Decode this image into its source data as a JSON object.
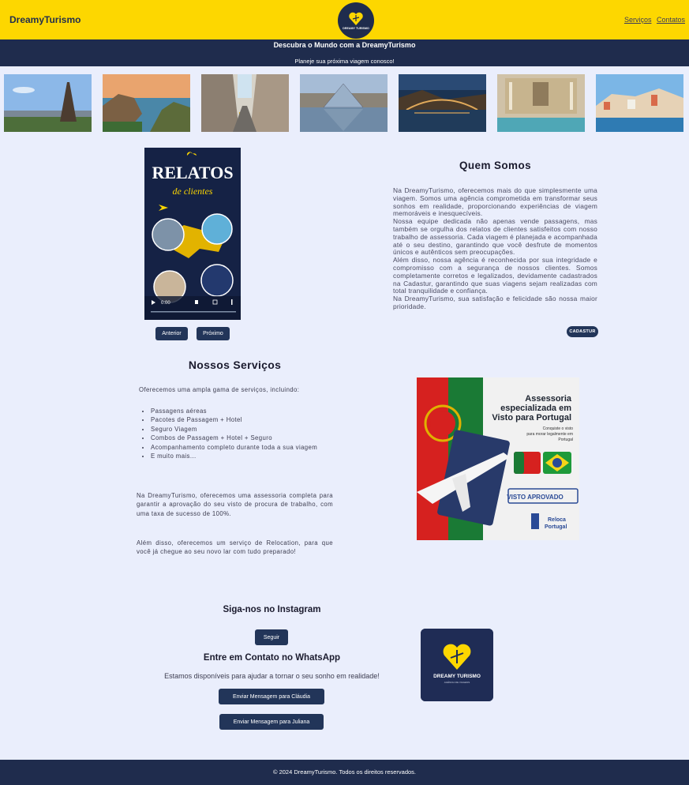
{
  "header": {
    "brand": "DreamyTurismo",
    "logo_text": "DREAMY TURISMO",
    "nav": [
      "Serviços",
      "Contatos"
    ]
  },
  "hero": {
    "title": "Descubra o Mundo com a DreamyTurismo",
    "subtitle": "Planeje sua próxima viagem conosco!"
  },
  "gallery": [
    "Torre Eiffel",
    "Costa",
    "Rua com bonde",
    "Louvre",
    "Ponte noturna",
    "Fontana di Trevi",
    "Cidade costeira"
  ],
  "video": {
    "title": "RELATOS",
    "subtitle": "de clientes",
    "time": "0:00",
    "prev_label": "Anterior",
    "next_label": "Próximo"
  },
  "about": {
    "title": "Quem Somos",
    "paragraphs": [
      "Na DreamyTurismo, oferecemos mais do que simplesmente uma viagem. Somos uma agência comprometida em transformar seus sonhos em realidade, proporcionando experiências de viagem memoráveis e inesquecíveis.",
      "Nossa equipe dedicada não apenas vende passagens, mas também se orgulha dos relatos de clientes satisfeitos com nosso trabalho de assessoria. Cada viagem é planejada e acompanhada até o seu destino, garantindo que você desfrute de momentos únicos e autênticos sem preocupações.",
      "Além disso, nossa agência é reconhecida por sua integridade e compromisso com a segurança de nossos clientes. Somos completamente corretos e legalizados, devidamente cadastrados na Cadastur, garantindo que suas viagens sejam realizadas com total tranquilidade e confiança.",
      "Na DreamyTurismo, sua satisfação e felicidade são nossa maior prioridade."
    ],
    "badge": "CADASTUR"
  },
  "services": {
    "title": "Nossos Serviços",
    "intro": "Oferecemos uma ampla gama de serviços, incluindo:",
    "items": [
      "Passagens aéreas",
      "Pacotes de Passagem + Hotel",
      "Seguro Viagem",
      "Combos de Passagem + Hotel + Seguro",
      "Acompanhamento completo durante toda a sua viagem",
      "E muito mais..."
    ],
    "p1": "Na DreamyTurismo, oferecemos uma assessoria completa para garantir a aprovação do seu visto de procura de trabalho, com uma taxa de sucesso de 100%.",
    "p2": "Além disso, oferecemos um serviço de Relocation, para que você já chegue ao seu novo lar com tudo preparado!"
  },
  "visa_ad": {
    "title_lines": [
      "Assessoria",
      "especializada em",
      "Visto para Portugal"
    ],
    "sub_lines": [
      "Conquiste o visto",
      "para morar legalmente em",
      "Portugal"
    ],
    "stamp": "VISTO APROVADO",
    "brand_lines": [
      "Reloca",
      "Portugal"
    ]
  },
  "instagram": {
    "title": "Siga-nos no Instagram",
    "button": "Seguir"
  },
  "whatsapp": {
    "title": "Entre em Contato no WhatsApp",
    "text": "Estamos disponíveis para ajudar a tornar o seu sonho em realidade!",
    "btn1": "Enviar Mensagem para Cláudia",
    "btn2": "Enviar Mensagem para Juliana"
  },
  "card": {
    "title": "DREAMY TURISMO",
    "tagline": "AGÊNCIA DE VIAGENS"
  },
  "footer": {
    "text": "© 2024 DreamyTurismo. Todos os direitos reservados."
  },
  "colors": {
    "yellow": "#fdd700",
    "navy": "#1f2c4d",
    "background": "#eaeefc"
  }
}
